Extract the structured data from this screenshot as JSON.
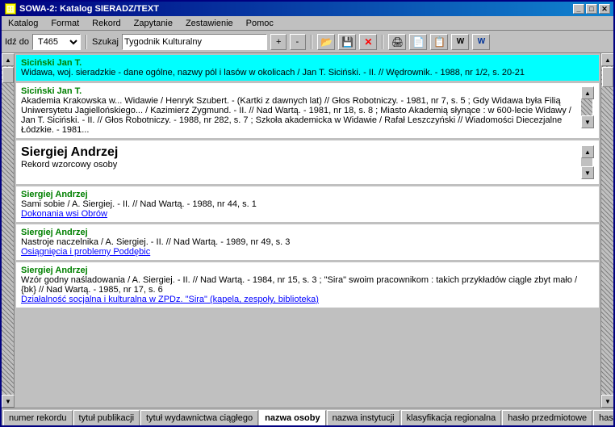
{
  "window": {
    "title": "SOWA-2: Katalog SIERADZ/TEXT",
    "title_icon": "🗄"
  },
  "title_buttons": [
    "_",
    "□",
    "✕"
  ],
  "menu": {
    "items": [
      "Katalog",
      "Format",
      "Rekord",
      "Zapytanie",
      "Zestawienie",
      "Pomoc"
    ]
  },
  "toolbar": {
    "goto_label": "Idź do",
    "goto_value": "T465",
    "search_label": "Szukaj",
    "search_value": "Tygodnik Kulturalny",
    "plus_label": "+",
    "minus_label": "-"
  },
  "records": [
    {
      "id": "r1",
      "author": "Siciński Jan T.",
      "text": "Widawa, woj. sieradzkie - dane ogólne, nazwy pól i lasów w okolicach / Jan T. Siciński. - II. // Wędrownik. - 1988, nr 1/2, s. 20-21",
      "highlighted": true,
      "link": null,
      "link_text": null
    },
    {
      "id": "r2",
      "author": "Siciński Jan T.",
      "text": "Akademia Krakowska w... Widawie / Henryk Szubert. - (Kartki z dawnych lat) // Głos Robotniczy. - 1981, nr 7, s. 5 ; Gdy Widawa była Filią Uniwersytetu Jagiellońskiego... / Kazimierz Zygmund. - II. // Nad Wartą. - 1981, nr 18, s. 8 ; Miasto Akademią słynące : w 600-lecie Widawy / Jan T. Siciński. - II. // Głos Robotniczy. - 1988, nr 282, s. 7 ; Szkoła akademicka w Widawie / Rafał Leszczyński // Wiadomości Diecezjalne Łódzkie. - 1981...",
      "highlighted": false,
      "link": null,
      "link_text": null
    },
    {
      "id": "r3",
      "type": "header",
      "author": "Siergiej Andrzej",
      "subtext": "Rekord wzorcowy osoby"
    },
    {
      "id": "r4",
      "author": "Siergiej Andrzej",
      "text": "Sami sobie / A. Siergiej. - II. // Nad Wartą. - 1988, nr 44, s. 1",
      "highlighted": false,
      "link": "Dokonania wsi Obrów",
      "link_text": "Dokonania wsi Obrów"
    },
    {
      "id": "r5",
      "author": "Siergiej Andrzej",
      "text": "Nastroje naczelnika / A. Siergiej. - II. // Nad Wartą. - 1989, nr 49, s. 3",
      "highlighted": false,
      "link": "Osiągnięcia i problemy Poddębic",
      "link_text": "Osiągnięcia i problemy Poddębic"
    },
    {
      "id": "r6",
      "author": "Siergiej Andrzej",
      "text": "Wzór godny naśladowania / A. Siergiej. - II. // Nad Wartą. - 1984, nr 15, s. 3 ; \"Sira\" swoim pracownikom : takich przykładów ciągle zbyt mało / {bk} // Nad Wartą. - 1985, nr 17, s. 6",
      "highlighted": false,
      "link": "Działalność socjalna i kulturalna w ZPDz. \"Sira\" (kapela, zespoły, biblioteka)",
      "link_text": "Działalność socjalna i kulturalna w ZPDz. \"Sira\" (kapela, zespoły, biblioteka)"
    }
  ],
  "bottom_tabs": [
    {
      "id": "t1",
      "label": "numer rekordu",
      "active": false
    },
    {
      "id": "t2",
      "label": "tytuł publikacji",
      "active": false
    },
    {
      "id": "t3",
      "label": "tytuł wydawnictwa ciągłego",
      "active": false
    },
    {
      "id": "t4",
      "label": "nazwa osoby",
      "active": true
    },
    {
      "id": "t5",
      "label": "nazwa instytucji",
      "active": false
    },
    {
      "id": "t6",
      "label": "klasyfikacja regionalna",
      "active": false
    },
    {
      "id": "t7",
      "label": "hasło przedmiotowe",
      "active": false
    },
    {
      "id": "t8",
      "label": "hast",
      "active": false
    }
  ],
  "icons": {
    "arrow_left": "◄",
    "arrow_right": "►",
    "arrow_up": "▲",
    "arrow_down": "▼",
    "scroll_up": "▲",
    "scroll_down": "▼",
    "minimize": "_",
    "maximize": "□",
    "close": "✕"
  }
}
